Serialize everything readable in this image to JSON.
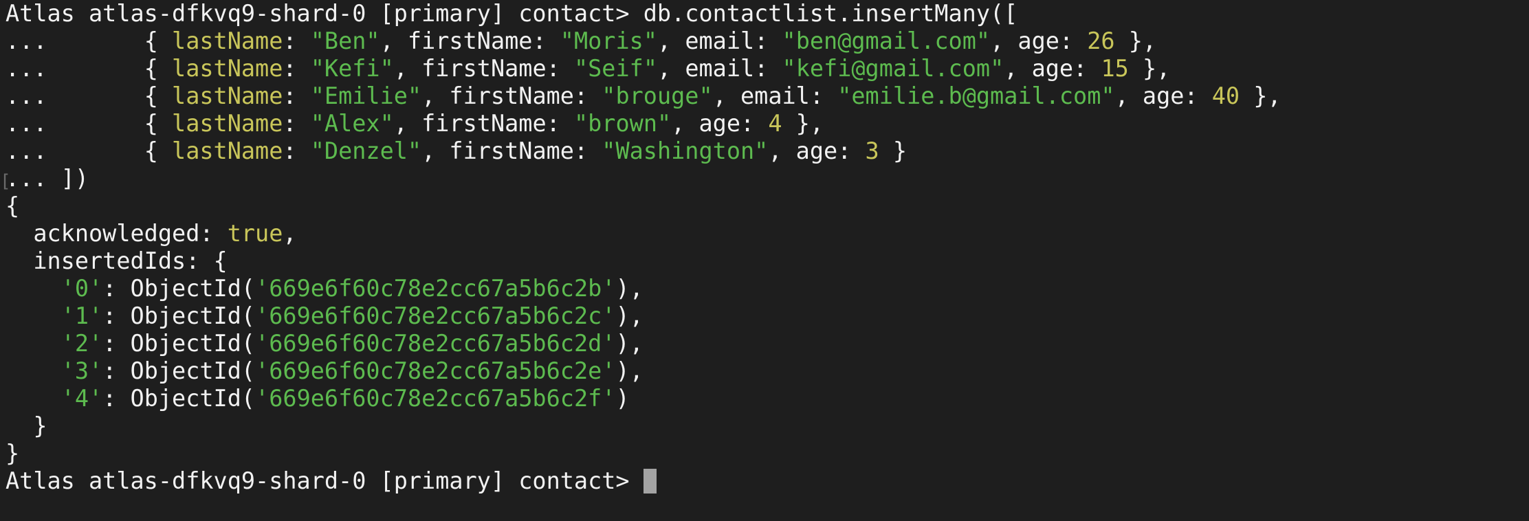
{
  "prompt": "Atlas atlas-dfkvq9-shard-0 [primary] contact> ",
  "command": "db.contactlist.insertMany([",
  "continuation_prefix": "...       ",
  "records": [
    {
      "lastName": "Ben",
      "firstName": "Moris",
      "email": "ben@gmail.com",
      "age": "26"
    },
    {
      "lastName": "Kefi",
      "firstName": "Seif",
      "email": "kefi@gmail.com",
      "age": "15"
    },
    {
      "lastName": "Emilie",
      "firstName": "brouge",
      "email": "emilie.b@gmail.com",
      "age": "40"
    },
    {
      "lastName": "Alex",
      "firstName": "brown",
      "age": "4"
    },
    {
      "lastName": "Denzel",
      "firstName": "Washington",
      "age": "3"
    }
  ],
  "close_line": "... ])",
  "result": {
    "open": "{",
    "acknowledged_key": "  acknowledged: ",
    "acknowledged_value": "true",
    "insertedIds_key": "  insertedIds: {",
    "ids": [
      {
        "index": "'0'",
        "value": "'669e6f60c78e2cc67a5b6c2b'"
      },
      {
        "index": "'1'",
        "value": "'669e6f60c78e2cc67a5b6c2c'"
      },
      {
        "index": "'2'",
        "value": "'669e6f60c78e2cc67a5b6c2d'"
      },
      {
        "index": "'3'",
        "value": "'669e6f60c78e2cc67a5b6c2e'"
      },
      {
        "index": "'4'",
        "value": "'669e6f60c78e2cc67a5b6c2f'"
      }
    ],
    "inner_close": "  }",
    "close": "}"
  },
  "colors": {
    "background": "#1e1e1e",
    "text": "#f2f2f2",
    "key": "#c9c65a",
    "string": "#5dbb4f",
    "number": "#c9c65a",
    "cursor": "#a3a3a3"
  }
}
